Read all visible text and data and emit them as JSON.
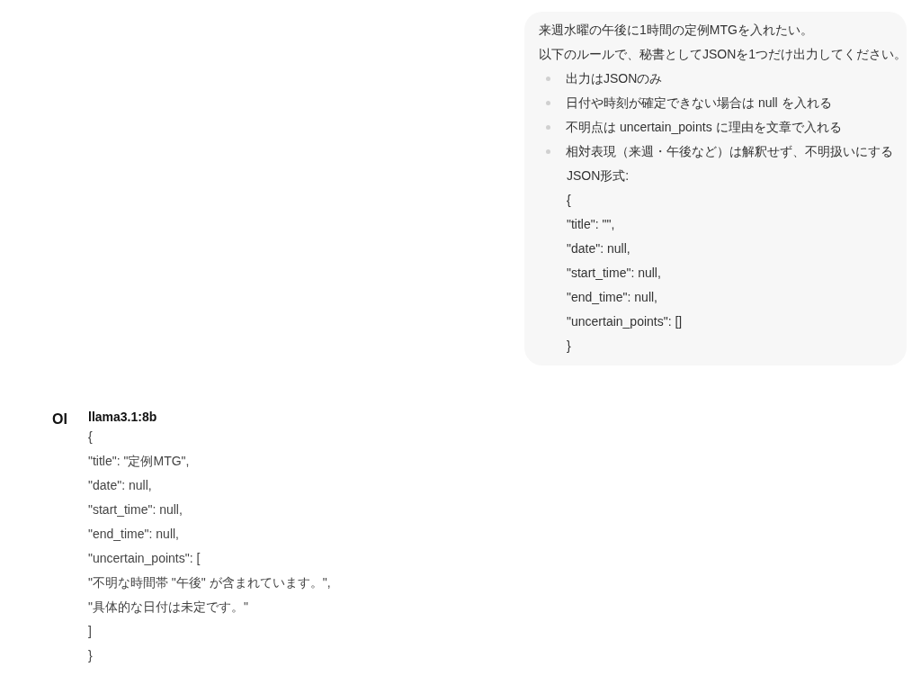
{
  "user_message": {
    "lines": [
      {
        "kind": "paragraph",
        "text": "来週水曜の午後に1時間の定例MTGを入れたい。"
      },
      {
        "kind": "paragraph",
        "text": "以下のルールで、秘書としてJSONを1つだけ出力してください。"
      },
      {
        "kind": "bullet",
        "text": "出力はJSONのみ"
      },
      {
        "kind": "bullet",
        "text": "日付や時刻が確定できない場合は null を入れる"
      },
      {
        "kind": "bullet",
        "text": "不明点は uncertain_points に理由を文章で入れる"
      },
      {
        "kind": "bullet",
        "text": "相対表現（来週・午後など）は解釈せず、不明扱いにする"
      },
      {
        "kind": "indented",
        "text": "JSON形式:"
      },
      {
        "kind": "indented",
        "text": "{"
      },
      {
        "kind": "indented",
        "text": "\"title\": \"\","
      },
      {
        "kind": "indented",
        "text": "\"date\": null,"
      },
      {
        "kind": "indented",
        "text": "\"start_time\": null,"
      },
      {
        "kind": "indented",
        "text": "\"end_time\": null,"
      },
      {
        "kind": "indented",
        "text": "\"uncertain_points\": []"
      },
      {
        "kind": "indented",
        "text": "}"
      }
    ]
  },
  "assistant_message": {
    "avatar": "OI",
    "model": "llama3.1:8b",
    "lines": [
      "{",
      "\"title\": \"定例MTG\",",
      "\"date\": null,",
      "\"start_time\": null,",
      "\"end_time\": null,",
      "\"uncertain_points\": [",
      "\"不明な時間帯 \"午後\" が含まれています。\",",
      "\"具体的な日付は未定です。\"",
      "]",
      "}"
    ]
  }
}
